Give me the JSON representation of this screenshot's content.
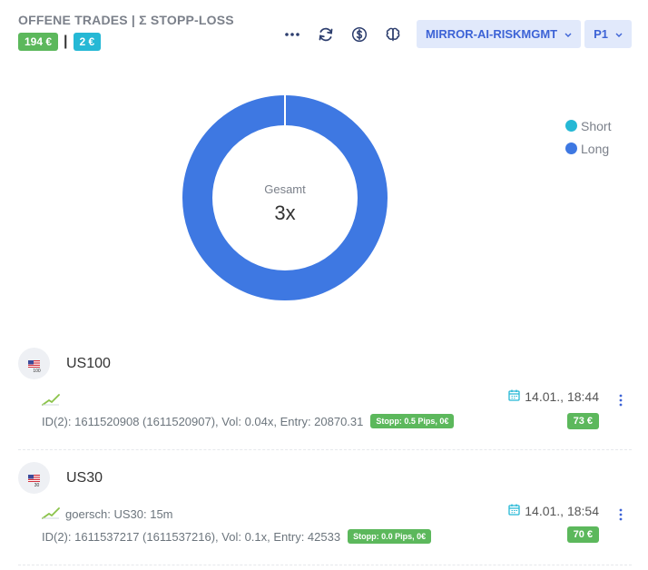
{
  "header": {
    "title": "OFFENE TRADES | Σ STOPP-LOSS",
    "badge_total": "194 €",
    "separator": "|",
    "badge_stop": "2 €"
  },
  "toolbar": {
    "icons": [
      "more-icon",
      "refresh-icon",
      "dollar-icon",
      "brain-icon"
    ],
    "strategy_dropdown": "MIRROR-AI-RISKMGMT",
    "portfolio_dropdown": "P1"
  },
  "chart_data": {
    "type": "pie",
    "categories": [
      "Short",
      "Long"
    ],
    "values": [
      0,
      3
    ],
    "colors": [
      "#25b8d5",
      "#3e78e2"
    ],
    "center_label": "Gesamt",
    "center_value": "3x",
    "legend_position": "top-right"
  },
  "trades": [
    {
      "symbol": "US100",
      "flag_sub": "100",
      "comment": "",
      "details": "ID(2): 1611520908 (1611520907), Vol: 0.04x, Entry: 20870.31",
      "stop": "Stopp: 0.5 Pips, 0€",
      "date": "14.01., 18:44",
      "pl": "73 €"
    },
    {
      "symbol": "US30",
      "flag_sub": "30",
      "comment": "goersch: US30: 15m",
      "details": "ID(2): 1611537217 (1611537216), Vol: 0.1x, Entry: 42533",
      "stop": "Stopp: 0.0 Pips, 0€",
      "date": "14.01., 18:54",
      "pl": "70 €"
    }
  ]
}
